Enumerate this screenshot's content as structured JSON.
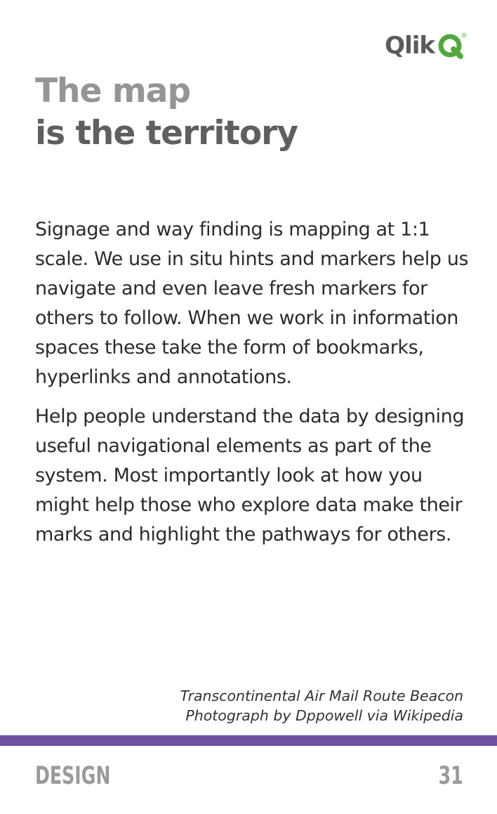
{
  "header": {
    "logo_text": "Qlik",
    "logo_icon": "qlik-q-icon",
    "brand_green": "#52a83f"
  },
  "title": {
    "line1": "The map",
    "line2": "is the territory"
  },
  "body": {
    "paragraphs": [
      "Signage and way finding is mapping at 1:1 scale. We use in situ hints and markers help us navigate and even leave fresh markers for others to follow. When we work in information spaces these take the form of bookmarks, hyperlinks and annotations.",
      "Help people understand the data by designing useful navigational elements as part of the system. Most importantly look at how you might help those who explore data make their marks and highlight the pathways for others."
    ]
  },
  "caption": {
    "line1": "Transcontinental Air Mail Route Beacon",
    "line2": "Photograph by Dppowell via Wikipedia"
  },
  "band_color": "#6d4fa4",
  "footer": {
    "section": "DESIGN",
    "page_number": "31"
  }
}
